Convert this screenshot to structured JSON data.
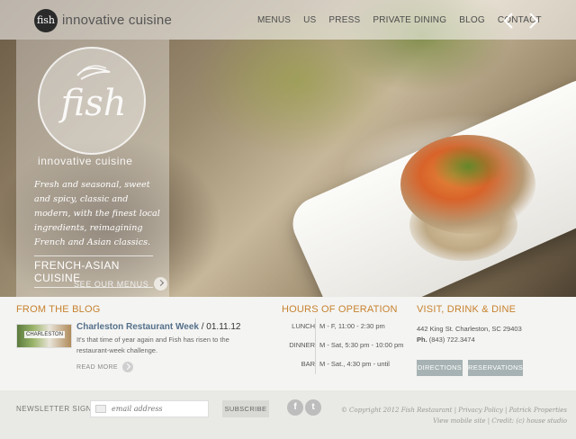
{
  "header": {
    "logo_badge": "fish",
    "brand": "innovative cuisine",
    "nav": [
      "MENUS",
      "US",
      "PRESS",
      "PRIVATE DINING",
      "BLOG",
      "CONTACT"
    ]
  },
  "hero": {
    "seal_word": "fish",
    "tagline": "innovative cuisine",
    "description": "Fresh and seasonal, sweet and spicy, classic and modern, with the finest local ingredients, reimagining French and Asian classics.",
    "cuisine": "FRENCH-ASIAN CUISINE",
    "see_menus": "SEE OUR MENUS"
  },
  "blog": {
    "title": "FROM THE BLOG",
    "thumb_text": "CHARLESTON",
    "post_title": "Charleston Restaurant Week",
    "post_date": " / 01.11.12",
    "excerpt": "It's that time of year again and Fish has risen to the restaurant-week challenge.",
    "read_more": "READ MORE"
  },
  "hours": {
    "title": "HOURS OF OPERATION",
    "rows": [
      {
        "label": "LUNCH",
        "value": "M - F, 11:00 - 2:30 pm"
      },
      {
        "label": "DINNER",
        "value": "M - Sat, 5:30 pm - 10:00 pm"
      },
      {
        "label": "BAR",
        "value": "M - Sat., 4:30 pm - until"
      }
    ]
  },
  "visit": {
    "title": "VISIT, DRINK & DINE",
    "address": "442 King St. Charleston, SC 29403",
    "phone_label": "Ph.",
    "phone": " (843) 722.3474",
    "directions": "DIRECTIONS",
    "reservations": "RESERVATIONS"
  },
  "footer": {
    "newsletter_label": "NEWSLETTER SIGNUP",
    "email_placeholder": "email address",
    "subscribe": "SUBSCRIBE",
    "social": [
      "f",
      "t"
    ],
    "copyright_line1": "© Copyright 2012 Fish Restaurant | Privacy Policy | Patrick Properties",
    "copyright_line2": "View mobile site | Credit: (c) house studio"
  },
  "colors": {
    "accent": "#c7822f",
    "link": "#54708b",
    "button": "#a6b2b3"
  },
  "icons": [
    "left-arrow-icon",
    "right-arrow-icon",
    "bird-icon",
    "mail-icon",
    "facebook-icon",
    "twitter-icon"
  ]
}
